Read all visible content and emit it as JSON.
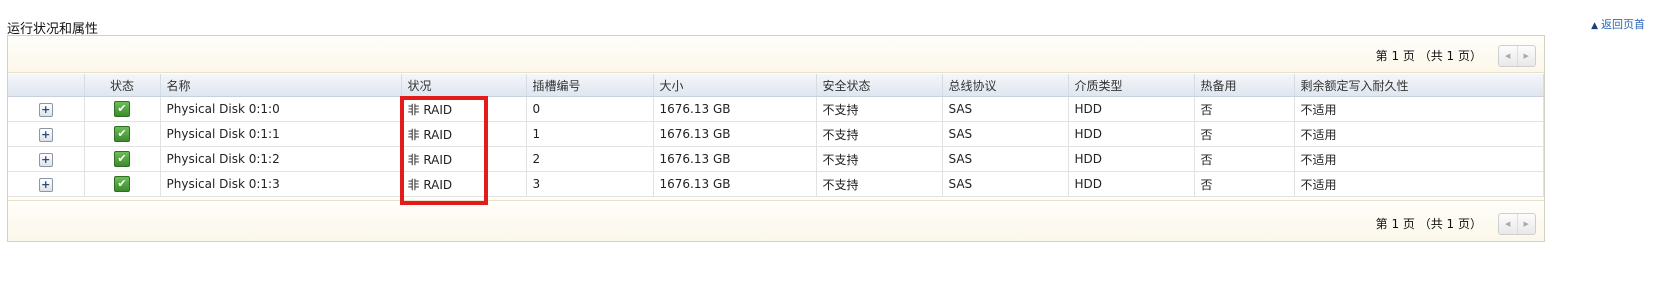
{
  "section": {
    "title": "运行状况和属性",
    "back_link": "返回页首"
  },
  "pager": {
    "top_text": "第 1 页 （共 1 页）",
    "bottom_text": "第 1 页 （共 1 页）",
    "prev": "◀",
    "next": "▶"
  },
  "table": {
    "headers": [
      "",
      "状态",
      "名称",
      "状况",
      "插槽编号",
      "大小",
      "安全状态",
      "总线协议",
      "介质类型",
      "热备用",
      "剩余额定写入耐久性"
    ],
    "rows": [
      {
        "expand": "+",
        "name": "Physical Disk 0:1:0",
        "condition": "非 RAID",
        "slot": "0",
        "size": "1676.13 GB",
        "security": "不支持",
        "bus": "SAS",
        "media": "HDD",
        "hotspare": "否",
        "endurance": "不适用"
      },
      {
        "expand": "+",
        "name": "Physical Disk 0:1:1",
        "condition": "非 RAID",
        "slot": "1",
        "size": "1676.13 GB",
        "security": "不支持",
        "bus": "SAS",
        "media": "HDD",
        "hotspare": "否",
        "endurance": "不适用"
      },
      {
        "expand": "+",
        "name": "Physical Disk 0:1:2",
        "condition": "非 RAID",
        "slot": "2",
        "size": "1676.13 GB",
        "security": "不支持",
        "bus": "SAS",
        "media": "HDD",
        "hotspare": "否",
        "endurance": "不适用"
      },
      {
        "expand": "+",
        "name": "Physical Disk 0:1:3",
        "condition": "非 RAID",
        "slot": "3",
        "size": "1676.13 GB",
        "security": "不支持",
        "bus": "SAS",
        "media": "HDD",
        "hotspare": "否",
        "endurance": "不适用"
      }
    ]
  },
  "colors": {
    "highlight": "#e31b1b",
    "status_ok": "#3c8a2e",
    "link": "#2a66b6"
  },
  "icons": {
    "status": "check-icon",
    "expand": "plus-icon",
    "back": "triangle-up-icon"
  }
}
